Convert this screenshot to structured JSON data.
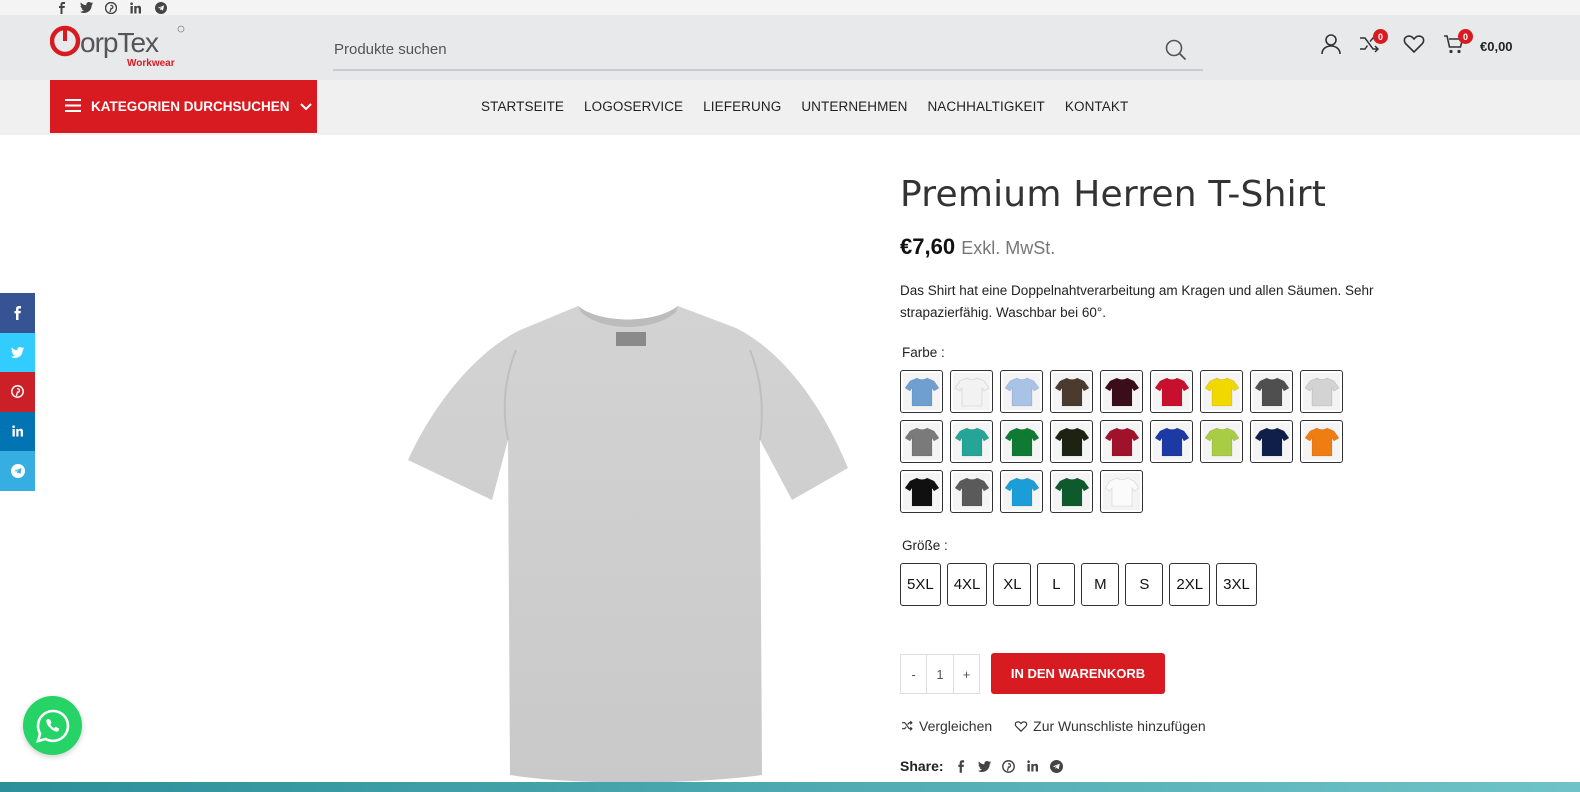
{
  "topbar": {
    "social": [
      "facebook-icon",
      "twitter-icon",
      "pinterest-icon",
      "linkedin-icon",
      "telegram-icon"
    ]
  },
  "header": {
    "logo_text": "CorpTex",
    "logo_sub": "Workwear",
    "search_placeholder": "Produkte suchen",
    "compare_count": "0",
    "cart_count": "0",
    "cart_total": "€0,00"
  },
  "nav": {
    "category_button": "KATEGORIEN DURCHSUCHEN",
    "menu": [
      "STARTSEITE",
      "LOGOSERVICE",
      "LIEFERUNG",
      "UNTERNEHMEN",
      "NACHHALTIGKEIT",
      "KONTAKT"
    ]
  },
  "product": {
    "title": "Premium Herren T-Shirt",
    "price": "€7,60",
    "tax_note": "Exkl. MwSt.",
    "description": "Das Shirt hat eine Doppelnahtverarbeitung am Kragen und allen Säumen. Sehr strapazierfähig. Waschbar bei 60°.",
    "color_label": "Farbe :",
    "colors": [
      "#6f9fd0",
      "#f2f2f2",
      "#a9c3e6",
      "#4a3b2e",
      "#3a0d18",
      "#c8102e",
      "#f0d800",
      "#4f4f4f",
      "#d3d3d3",
      "#7a7a7a",
      "#24a597",
      "#0f7a33",
      "#1d2312",
      "#a0122a",
      "#1b3aa3",
      "#a9cc45",
      "#0f1f4a",
      "#f07d12",
      "#101010",
      "#5a5a5a",
      "#1b9ed8",
      "#0e5a2c",
      "#fbfbfb"
    ],
    "size_label": "Größe :",
    "sizes": [
      "5XL",
      "4XL",
      "XL",
      "L",
      "M",
      "S",
      "2XL",
      "3XL"
    ],
    "qty_minus": "-",
    "qty_value": "1",
    "qty_plus": "+",
    "add_to_cart": "IN DEN WARENKORB",
    "compare": "Vergleichen",
    "wishlist": "Zur Wunschliste hinzufügen",
    "share_label": "Share:"
  },
  "sidebar_share": [
    "facebook-icon",
    "twitter-icon",
    "pinterest-icon",
    "linkedin-icon",
    "telegram-icon"
  ],
  "colors": {
    "brand_red": "#d81b20",
    "facebook": "#365493",
    "twitter": "#3cf",
    "pinterest": "#cb2027",
    "linkedin": "#0274b3",
    "telegram": "#37aee2",
    "whatsapp": "#25d366"
  }
}
